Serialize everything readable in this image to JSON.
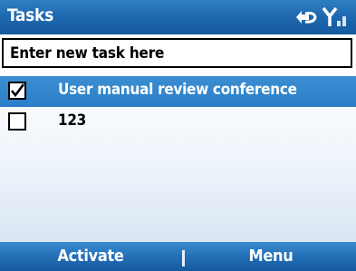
{
  "header": {
    "title": "Tasks"
  },
  "status": {
    "icons": [
      "sync-icon",
      "signal-icon"
    ]
  },
  "new_task": {
    "placeholder": "Enter new task here"
  },
  "tasks": [
    {
      "label": "User manual review conference",
      "checked": true,
      "selected": true
    },
    {
      "label": "123",
      "checked": false,
      "selected": false
    }
  ],
  "softkeys": {
    "left": "Activate",
    "right": "Menu"
  },
  "colors": {
    "accent": "#1f69b0",
    "selection": "#2f83c9",
    "text": "#000000"
  }
}
